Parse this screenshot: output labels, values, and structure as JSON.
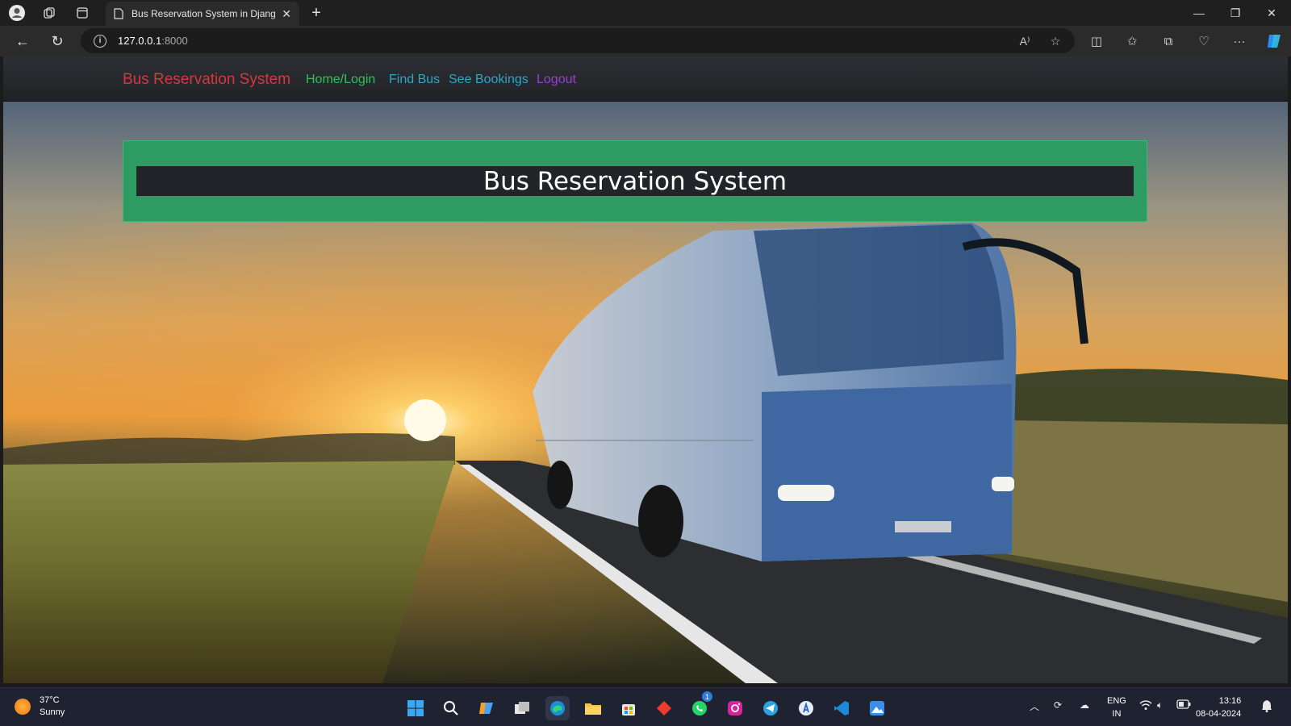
{
  "browser": {
    "tab_title": "Bus Reservation System in Djang",
    "url_host": "127.0.0.1",
    "url_port": ":8000"
  },
  "site": {
    "brand": "Bus Reservation System",
    "nav": [
      {
        "label": "Home/Login",
        "color": "#2fc25b"
      },
      {
        "label": "Find Bus",
        "color": "#2fa7c7"
      },
      {
        "label": "See Bookings",
        "color": "#2fa7c7"
      },
      {
        "label": "Logout",
        "color": "#9b3fd6"
      }
    ],
    "banner_title": "Bus Reservation System",
    "banner_color": "#2e9b63"
  },
  "taskbar": {
    "weather_temp": "37°C",
    "weather_desc": "Sunny",
    "lang_top": "ENG",
    "lang_bottom": "IN",
    "time": "13:16",
    "date": "08-04-2024",
    "whatsapp_badge": "1"
  }
}
